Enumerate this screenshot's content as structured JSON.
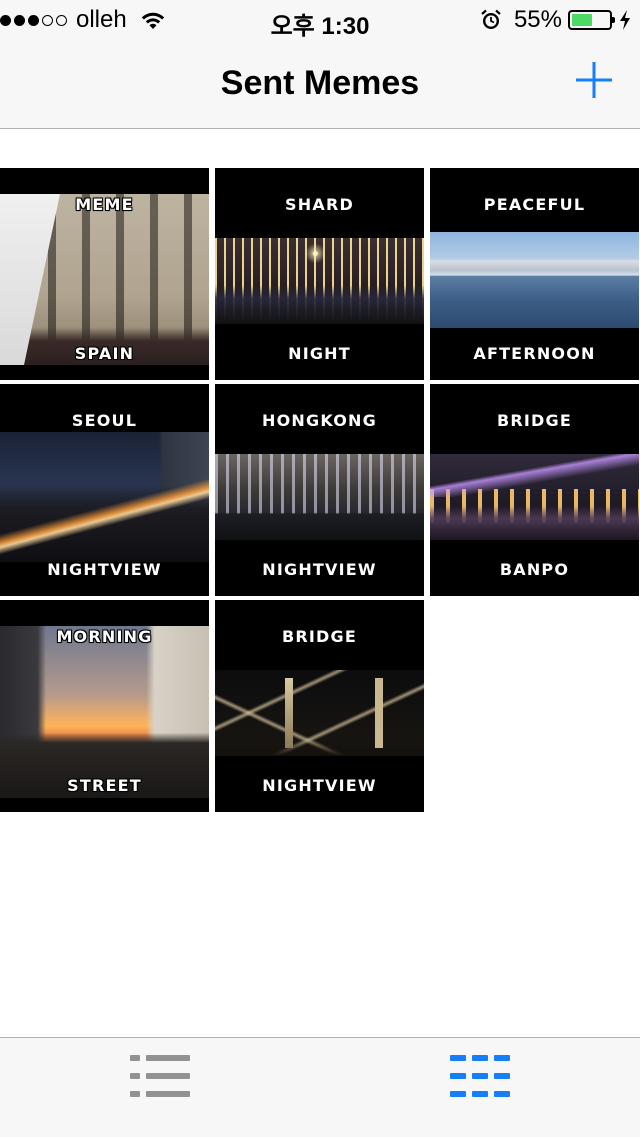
{
  "status_bar": {
    "carrier": "olleh",
    "time": "오후 1:30",
    "battery_percent": "55%",
    "battery_level": 0.55,
    "signal_bars_filled": 3,
    "signal_bars_total": 5,
    "battery_fill_color": "#4cd964"
  },
  "nav_bar": {
    "title": "Sent Memes",
    "add_icon": "plus-icon",
    "accent_color": "#147efb"
  },
  "memes": [
    {
      "top": "MEME",
      "bottom": "SPAIN"
    },
    {
      "top": "SHARD",
      "bottom": "NIGHT"
    },
    {
      "top": "PEACEFUL",
      "bottom": "AFTERNOON"
    },
    {
      "top": "SEOUL",
      "bottom": "NIGHTVIEW"
    },
    {
      "top": "HONGKONG",
      "bottom": "NIGHTVIEW"
    },
    {
      "top": "BRIDGE",
      "bottom": "BANPO"
    },
    {
      "top": "MORNING",
      "bottom": "STREET"
    },
    {
      "top": "BRIDGE",
      "bottom": "NIGHTVIEW"
    }
  ],
  "tab_bar": {
    "tabs": [
      {
        "icon": "list-icon",
        "selected": false
      },
      {
        "icon": "grid-icon",
        "selected": true
      }
    ],
    "selected_color": "#147efb",
    "unselected_color": "#929292"
  }
}
